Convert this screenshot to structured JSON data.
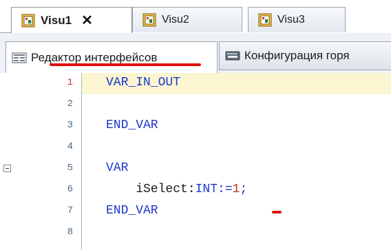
{
  "tabs": [
    {
      "label": "Visu1",
      "active": true,
      "has_close": true,
      "close_glyph": "✕"
    },
    {
      "label": "Visu2",
      "active": false
    },
    {
      "label": "Visu3",
      "active": false
    }
  ],
  "subtabs": [
    {
      "label": "Редактор интерфейсов",
      "active": true,
      "icon": "interface-editor-icon"
    },
    {
      "label": "Конфигурация горя",
      "active": false,
      "icon": "keyboard-icon"
    }
  ],
  "editor": {
    "current_line": 1,
    "lines": [
      {
        "n": "1",
        "tokens": [
          {
            "t": "VAR_IN_OUT",
            "k": "kw"
          }
        ]
      },
      {
        "n": "2",
        "tokens": []
      },
      {
        "n": "3",
        "tokens": [
          {
            "t": "END_VAR",
            "k": "kw"
          }
        ]
      },
      {
        "n": "4",
        "tokens": []
      },
      {
        "n": "5",
        "tokens": [
          {
            "t": "VAR",
            "k": "kw"
          }
        ],
        "fold": true
      },
      {
        "n": "6",
        "tokens": [
          {
            "t": "    iSelect:",
            "k": "id"
          },
          {
            "t": "INT",
            "k": "kw"
          },
          {
            "t": ":=",
            "k": "kw"
          },
          {
            "t": "1",
            "k": "num"
          },
          {
            "t": ";",
            "k": "kw"
          }
        ]
      },
      {
        "n": "7",
        "tokens": [
          {
            "t": "END_VAR",
            "k": "kw"
          }
        ]
      },
      {
        "n": "8",
        "tokens": []
      }
    ]
  },
  "colors": {
    "keyword": "#1d37c9",
    "number": "#c42a1d",
    "annotation": "#e0110e",
    "current_line_bg": "#fbf6d1"
  }
}
